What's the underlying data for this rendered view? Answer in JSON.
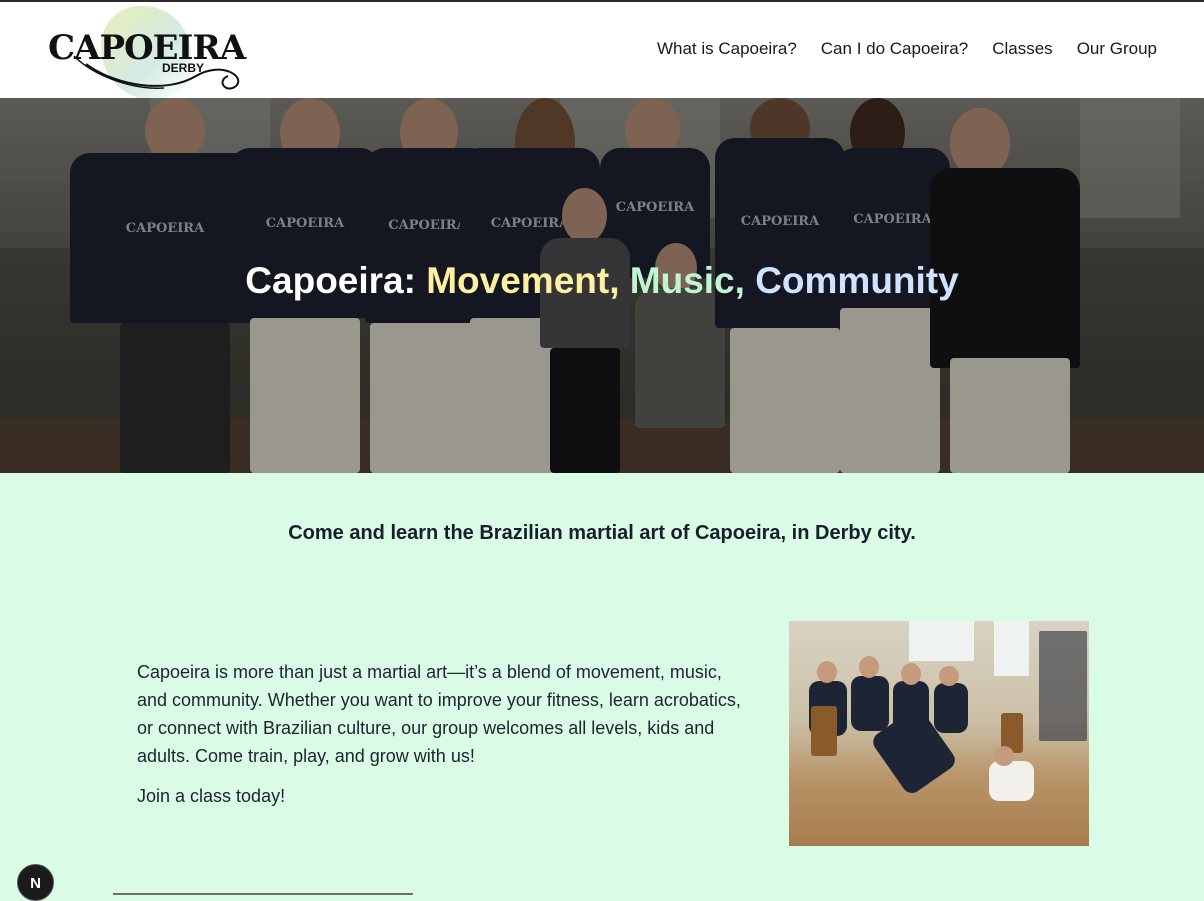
{
  "logo": {
    "wordmark": "CAPOEIRA",
    "sub": "DERBY"
  },
  "nav": {
    "items": [
      {
        "label": "What is Capoeira?"
      },
      {
        "label": "Can I do Capoeira?"
      },
      {
        "label": "Classes"
      },
      {
        "label": "Our Group"
      }
    ]
  },
  "hero": {
    "prefix": "Capoeira: ",
    "word1": "Movement,",
    "word2": "Music,",
    "word3": "Community",
    "shirt_print": "CAPOEIRA",
    "colors": {
      "word1": "#fdf0a0",
      "word2": "#bff5d2",
      "word3": "#cfe3ff"
    }
  },
  "tagline": "Come and learn the Brazilian martial art of Capoeira, in Derby city.",
  "intro": {
    "paragraph": "Capoeira is more than just a martial art—it’s a blend of movement, music, and community. Whether you want to improve your fitness, learn acrobatics, or connect with Brazilian culture, our group welcomes all levels, kids and adults. Come train, play, and grow with us!",
    "cta": "Join a class today!"
  },
  "dev_badge": {
    "letter": "N"
  },
  "colors": {
    "page_bg": "#dafbe5",
    "header_bg": "#ffffff",
    "text": "#17202a"
  }
}
